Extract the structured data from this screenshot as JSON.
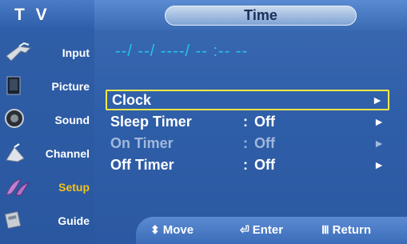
{
  "sidebar": {
    "title": "T V",
    "items": [
      {
        "label": "Input",
        "icon": "input-icon"
      },
      {
        "label": "Picture",
        "icon": "picture-icon"
      },
      {
        "label": "Sound",
        "icon": "sound-icon"
      },
      {
        "label": "Channel",
        "icon": "channel-icon"
      },
      {
        "label": "Setup",
        "icon": "setup-icon",
        "active": true
      },
      {
        "label": "Guide",
        "icon": "guide-icon"
      }
    ]
  },
  "header": {
    "title": "Time"
  },
  "datetime": "--/ --/ ----/ -- :-- --",
  "menu": [
    {
      "label": "Clock",
      "colon": "",
      "value": "",
      "arrow": "►",
      "state": "selected"
    },
    {
      "label": "Sleep Timer",
      "colon": ":",
      "value": "Off",
      "arrow": "►",
      "state": "enabled"
    },
    {
      "label": "On Timer",
      "colon": ":",
      "value": "Off",
      "arrow": "►",
      "state": "disabled"
    },
    {
      "label": "Off Timer",
      "colon": ":",
      "value": "Off",
      "arrow": "►",
      "state": "enabled"
    }
  ],
  "footer": {
    "move": "Move",
    "enter": "Enter",
    "return": "Return"
  },
  "colors": {
    "accent": "#f4c21a",
    "highlight_border": "#f2e84a",
    "datetime": "#26c2ee",
    "panel": "#2f5ea8"
  }
}
